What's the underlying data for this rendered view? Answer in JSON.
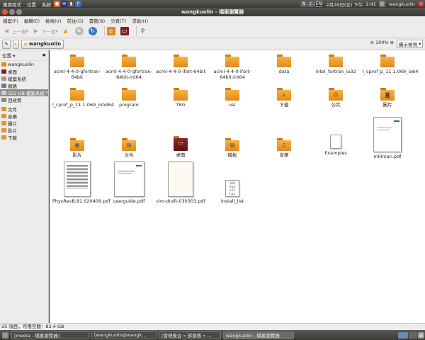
{
  "top_panel": {
    "menus": [
      "應用程式",
      "位置",
      "系統"
    ],
    "im_label": "EN",
    "date": "2月26日(五) 下午",
    "time": "2:41",
    "user": "wangkuolin"
  },
  "window": {
    "title": "wangkuolin - 檔案瀏覽器"
  },
  "menubar": [
    "檔案(F)",
    "編輯(E)",
    "檢視(V)",
    "前往(G)",
    "書籤(B)",
    "分頁(T)",
    "求助(H)"
  ],
  "toolbar": {
    "back_label": "上一頁",
    "forward_label": "下一頁"
  },
  "location": {
    "crumb": "wangkuolin",
    "zoom": "100%",
    "view_mode": "圖示檢視"
  },
  "sidebar": {
    "header": "位置",
    "items": [
      {
        "label": "wangkuolin",
        "icon": "home-icon"
      },
      {
        "label": "桌面",
        "icon": "desktop-icon"
      },
      {
        "label": "檔案系統",
        "icon": "drive-icon"
      },
      {
        "label": "網路",
        "icon": "network-icon"
      },
      {
        "label": "322 GB 檔案系統",
        "icon": "drive-icon"
      },
      {
        "label": "回收筒",
        "icon": "trash-icon"
      },
      {
        "label": "文件",
        "icon": "folder-icon"
      },
      {
        "label": "音樂",
        "icon": "folder-icon"
      },
      {
        "label": "圖片",
        "icon": "folder-icon"
      },
      {
        "label": "影片",
        "icon": "folder-icon"
      },
      {
        "label": "下載",
        "icon": "folder-icon"
      }
    ]
  },
  "files": [
    {
      "name": "acml-4-4-0-gfortran-64bit",
      "type": "folder"
    },
    {
      "name": "acml-4-4-0-gfortran-64bit-int64",
      "type": "folder"
    },
    {
      "name": "acml-4-4-0-ifort-64bit",
      "type": "folder"
    },
    {
      "name": "acml-4-4-0-ifort-64bit-int64",
      "type": "folder"
    },
    {
      "name": "data",
      "type": "folder"
    },
    {
      "name": "intel_fortran_ia32",
      "type": "folder"
    },
    {
      "name": "l_cprof_p_11.1.069_ia64",
      "type": "folder"
    },
    {
      "name": "l_cprof_p_11.1.069_intel64",
      "type": "folder"
    },
    {
      "name": "program",
      "type": "folder"
    },
    {
      "name": "TRG",
      "type": "folder"
    },
    {
      "name": "usr",
      "type": "folder"
    },
    {
      "name": "下載",
      "type": "folder-download"
    },
    {
      "name": "公共",
      "type": "folder-public"
    },
    {
      "name": "圖片",
      "type": "folder-pictures"
    },
    {
      "name": "影片",
      "type": "folder-videos"
    },
    {
      "name": "文件",
      "type": "folder-documents"
    },
    {
      "name": "桌面",
      "type": "folder-desktop"
    },
    {
      "name": "模板",
      "type": "folder-templates"
    },
    {
      "name": "音樂",
      "type": "folder-music"
    },
    {
      "name": "Examples",
      "type": "file-link"
    },
    {
      "name": "mklman.pdf",
      "type": "pdf"
    },
    {
      "name": "PhysRevB.81.020409.pdf",
      "type": "pdf"
    },
    {
      "name": "userguide.pdf",
      "type": "pdf"
    },
    {
      "name": "vim-draft-030303.pdf",
      "type": "pdf"
    },
    {
      "name": "install_list",
      "type": "text"
    }
  ],
  "status": "25 項目，可用空間：82.4 GB",
  "taskbar": [
    "[media - 檔案瀏覽器]",
    "[wangkuolin@wangk...",
    "[管理後台 » 部落格 » ...",
    "wangkuolin - 檔案瀏覽器"
  ],
  "colors": {
    "folder": "#f0a033",
    "panel": "#3c3b37",
    "selection": "#8d8d8b"
  }
}
